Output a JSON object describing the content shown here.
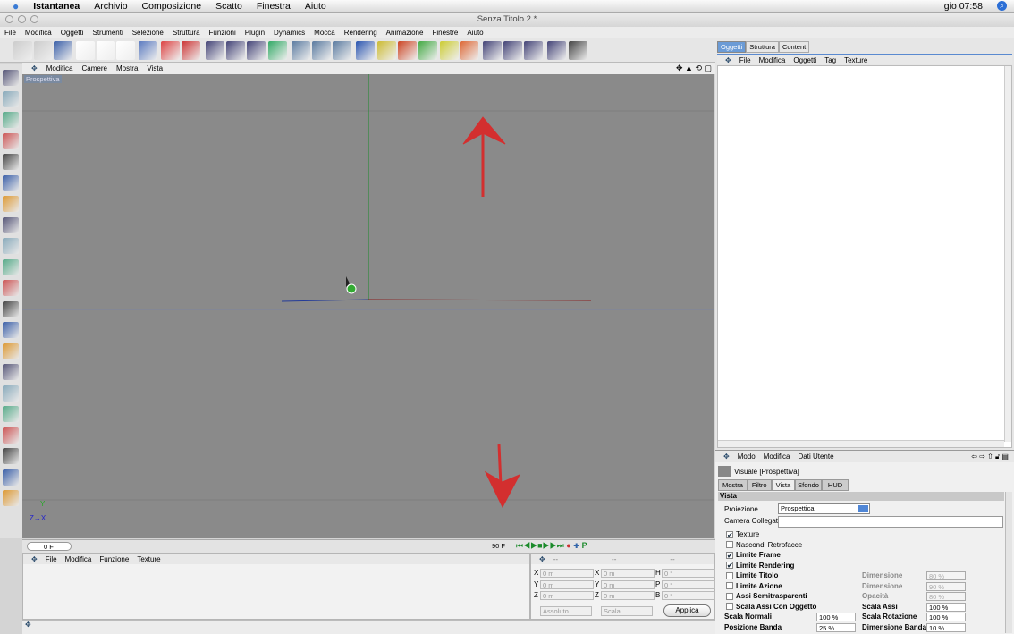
{
  "macmenu": {
    "app": "Istantanea",
    "items": [
      "Archivio",
      "Composizione",
      "Scatto",
      "Finestra",
      "Aiuto"
    ],
    "clock": "gio 07:58"
  },
  "window": {
    "title": "Senza Titolo 2 *"
  },
  "appmenu": [
    "File",
    "Modifica",
    "Oggetti",
    "Strumenti",
    "Selezione",
    "Struttura",
    "Funzioni",
    "Plugin",
    "Dynamics",
    "Mocca",
    "Rendering",
    "Animazione",
    "Finestre",
    "Aiuto"
  ],
  "viewport": {
    "menu": [
      "Modifica",
      "Camere",
      "Mostra",
      "Vista"
    ],
    "label": "Prospettiva",
    "axis_y": "Y",
    "axis_zx": "Z→X"
  },
  "timeline": {
    "current": "0 F",
    "end": "90 F"
  },
  "material_manager": {
    "menu": [
      "File",
      "Modifica",
      "Funzione",
      "Texture"
    ]
  },
  "coords": {
    "headers": [
      "--",
      "--",
      "--"
    ],
    "rows": [
      [
        "X",
        "0 m",
        "X",
        "0 m",
        "H",
        "0 °"
      ],
      [
        "Y",
        "0 m",
        "Y",
        "0 m",
        "P",
        "0 °"
      ],
      [
        "Z",
        "0 m",
        "Z",
        "0 m",
        "B",
        "0 °"
      ]
    ],
    "mode": "Assoluto",
    "scale": "Scala",
    "apply": "Applica"
  },
  "right": {
    "tabs": [
      "Oggetti",
      "Struttura",
      "Content"
    ],
    "obj_menu": [
      "File",
      "Modifica",
      "Oggetti",
      "Tag",
      "Texture"
    ]
  },
  "attributes": {
    "menu": [
      "Modo",
      "Modifica",
      "Dati Utente"
    ],
    "title": "Visuale [Prospettiva]",
    "tabs": [
      "Mostra",
      "Filtro",
      "Vista",
      "Sfondo",
      "HUD"
    ],
    "section": "Vista",
    "proiezione_label": "Proiezione",
    "proiezione": "Prospettica",
    "camera_label": "Camera Collegata",
    "checks": [
      {
        "label": "Texture",
        "checked": true,
        "bold": false
      },
      {
        "label": "Nascondi Retrofacce",
        "checked": false,
        "bold": false
      },
      {
        "label": "Limite Frame",
        "checked": true,
        "bold": true
      },
      {
        "label": "Limite Rendering",
        "checked": true,
        "bold": true
      },
      {
        "label": "Limite Titolo",
        "checked": false,
        "bold": true
      },
      {
        "label": "Limite Azione",
        "checked": false,
        "bold": true
      },
      {
        "label": "Assi Semitrasparenti",
        "checked": false,
        "bold": true
      },
      {
        "label": "Scala Assi Con Oggetto",
        "checked": false,
        "bold": true
      }
    ],
    "right_fields": [
      {
        "label": "Dimensione",
        "value": "80 %",
        "disabled": true
      },
      {
        "label": "Dimensione",
        "value": "90 %",
        "disabled": true
      },
      {
        "label": "Opacità",
        "value": "80 %",
        "disabled": true
      },
      {
        "label": "Scala Assi",
        "value": "100 %",
        "disabled": false
      }
    ],
    "bottom": [
      {
        "label": "Scala Normali",
        "value": "100 %",
        "label2": "Scala Rotazione",
        "value2": "100 %"
      },
      {
        "label": "Posizione Banda",
        "value": "25 %",
        "label2": "Dimensione Banda",
        "value2": "10 %"
      }
    ]
  }
}
